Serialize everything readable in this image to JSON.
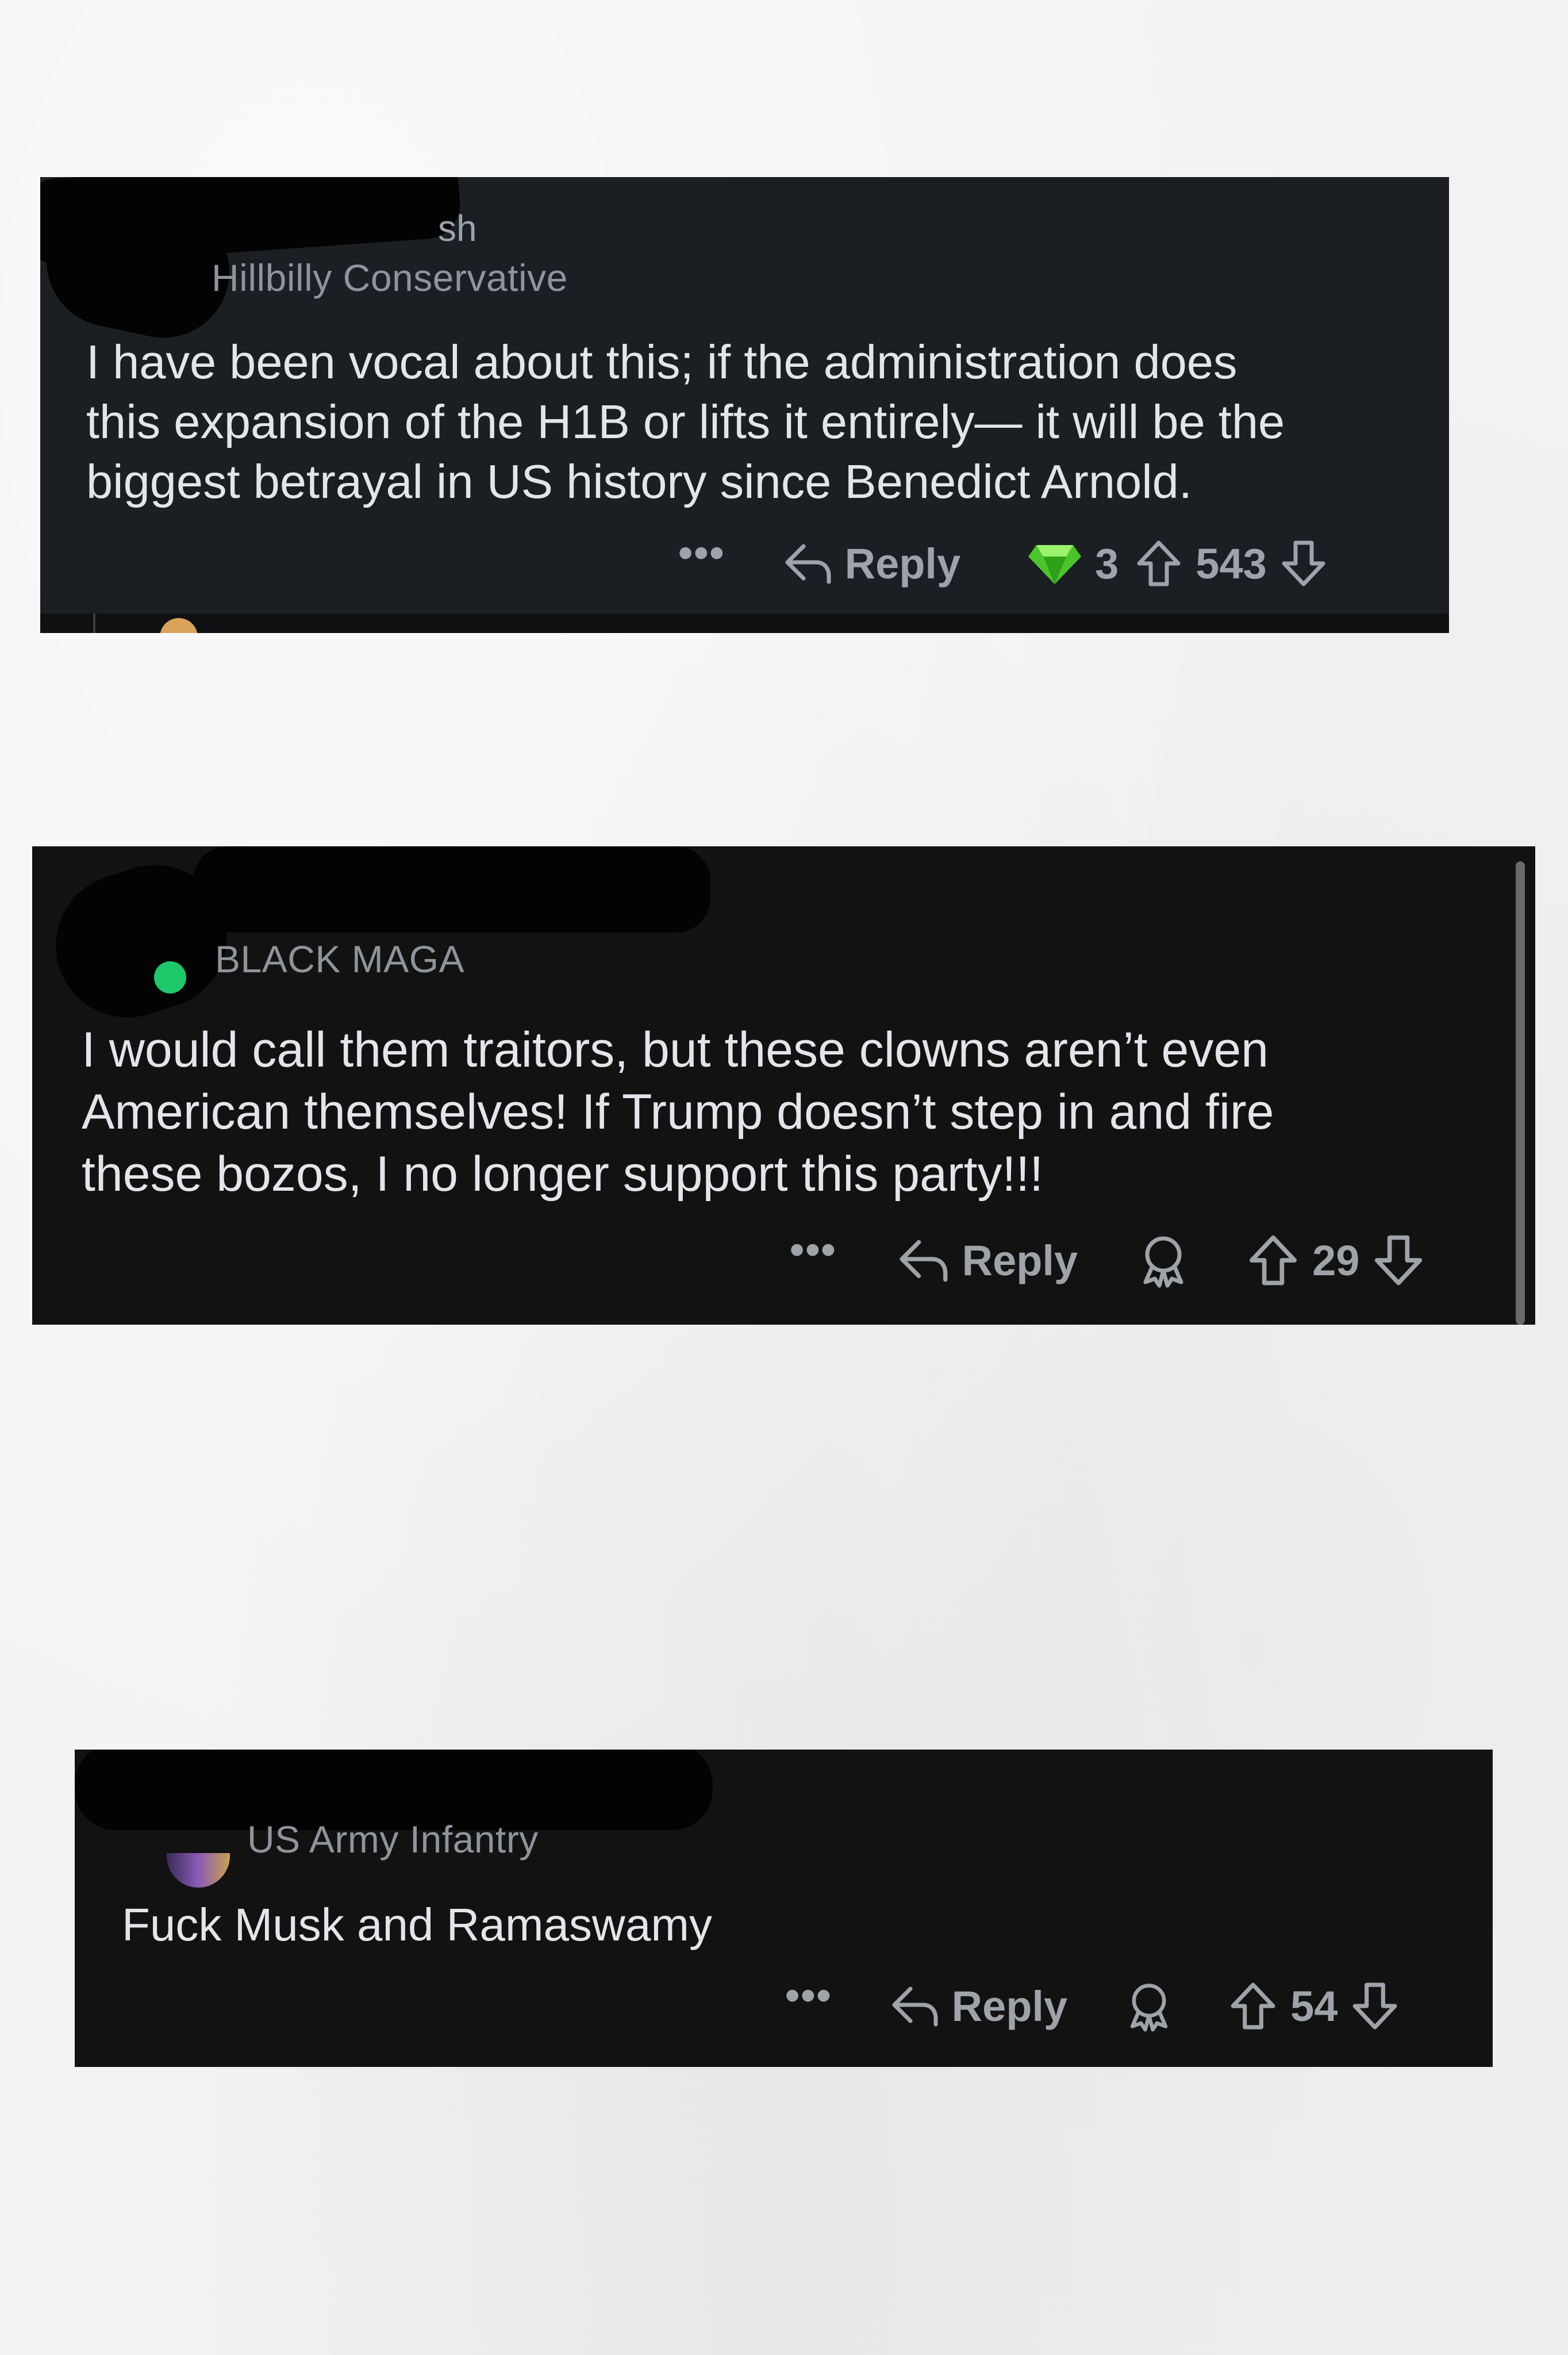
{
  "comments": [
    {
      "username": "sh",
      "flair": "Hillbilly Conservative",
      "body": "I have been vocal about this; if the administration does\nthis expansion of the H1B or lifts it entirely— it will be the\nbiggest betrayal in US history since Benedict Arnold.",
      "more_label": "•••",
      "reply_label": "Reply",
      "award_icon": "gem-icon",
      "award_count": "3",
      "score": "543"
    },
    {
      "flair": "BLACK MAGA",
      "body": "I would call them traitors, but these clowns aren’t even\nAmerican themselves! If Trump doesn’t step in and fire\nthese bozos, I no longer support this party!!!",
      "more_label": "•••",
      "reply_label": "Reply",
      "award_icon": "award-icon",
      "score": "29"
    },
    {
      "flair": "US Army Infantry",
      "body": "Fuck Musk and Ramaswamy",
      "more_label": "•••",
      "reply_label": "Reply",
      "award_icon": "award-icon",
      "score": "54"
    }
  ],
  "colors": {
    "card1_bg": "#1b1e22",
    "card_bg": "#121213",
    "text": "#e2e5e9",
    "muted": "#9ea3a9",
    "gem": "#5fd33a",
    "online_dot": "#1ec96b"
  }
}
